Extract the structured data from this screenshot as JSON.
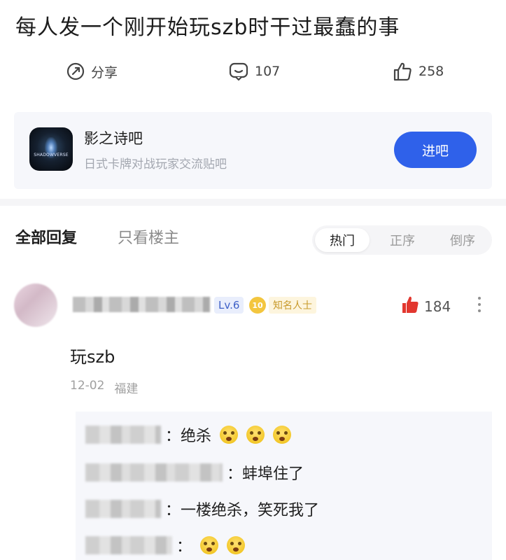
{
  "post": {
    "title": "每人发一个刚开始玩szb时干过最蠢的事"
  },
  "actions": {
    "share_label": "分享",
    "comment_count": "107",
    "like_count": "258"
  },
  "forum": {
    "name": "影之诗吧",
    "description": "日式卡牌对战玩家交流贴吧",
    "enter_label": "进吧",
    "logo_text": "SHADOWVERSE"
  },
  "reply_tabs": {
    "all": "全部回复",
    "op_only": "只看楼主"
  },
  "sort": {
    "options": [
      "热门",
      "正序",
      "倒序"
    ],
    "selected": "热门"
  },
  "comment": {
    "level": "Lv.6",
    "badge_icon": "10",
    "badge": "知名人士",
    "likes": "184",
    "content": "玩szb",
    "date": "12-02",
    "location": "福建",
    "sub_replies": [
      {
        "sep": "：",
        "text": "绝杀",
        "emojis": 3
      },
      {
        "sep": "：",
        "text": "蚌埠住了",
        "emojis": 0
      },
      {
        "sep": "：",
        "text": "一楼绝杀，笑死我了",
        "emojis": 0
      },
      {
        "sep": "：",
        "text": "",
        "emojis": 2
      }
    ]
  },
  "colors": {
    "accent_blue": "#2f61ea",
    "like_red": "#e2372f",
    "card_bg": "#f6f7fb",
    "muted_text": "#a3a7b0"
  },
  "icons": {
    "share": "share-icon",
    "comment": "comment-icon",
    "like": "thumbs-up-icon",
    "liked": "thumbs-up-filled-icon",
    "more": "more-vertical-icon",
    "emoji": "face-emoji-icon"
  }
}
